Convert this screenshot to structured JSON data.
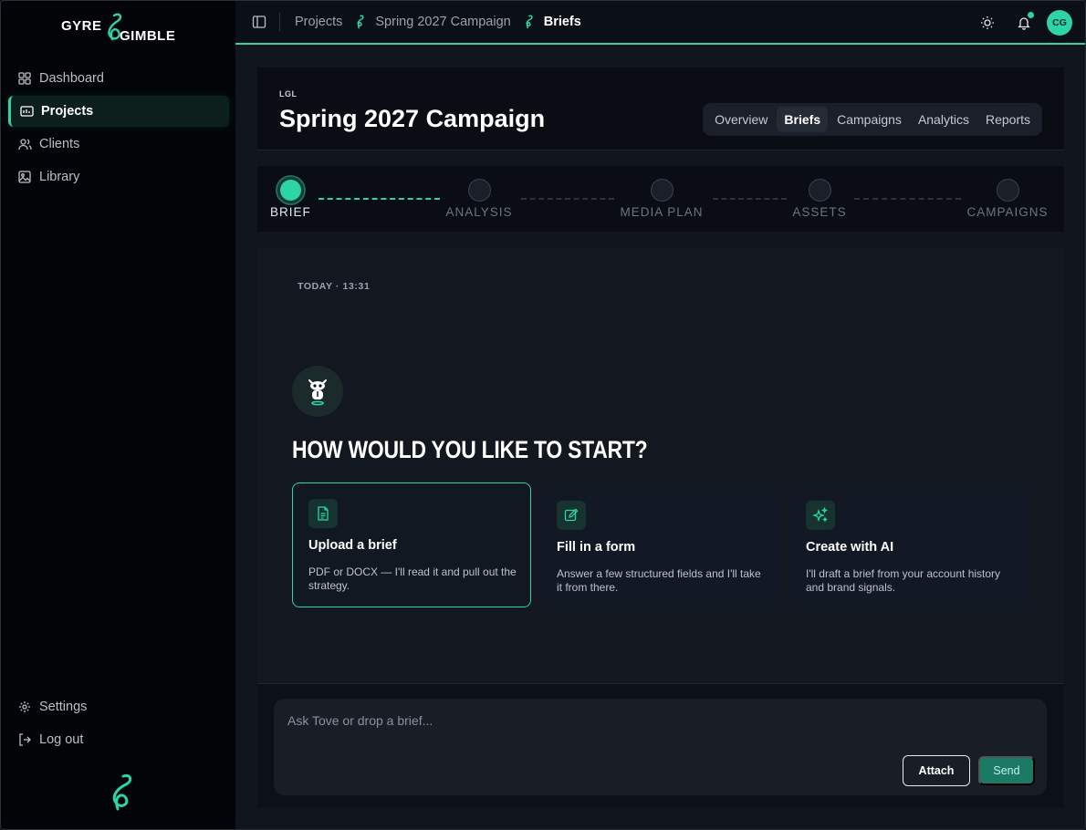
{
  "sidebar": {
    "brand": "GYRE & GIMBLE",
    "nav": [
      {
        "label": "Dashboard",
        "icon": "grid-icon"
      },
      {
        "label": "Projects",
        "icon": "folder-icon",
        "active": true
      },
      {
        "label": "Clients",
        "icon": "users-icon"
      },
      {
        "label": "Library",
        "icon": "image-icon"
      }
    ],
    "bottom_nav": [
      {
        "label": "Settings",
        "icon": "gear-icon"
      },
      {
        "label": "Log out",
        "icon": "logout-icon"
      }
    ]
  },
  "topbar": {
    "breadcrumbs": [
      "Projects",
      "Spring 2027 Campaign",
      "Briefs"
    ],
    "avatar_initials": "CG"
  },
  "header": {
    "client": "LGL",
    "title": "Spring 2027 Campaign",
    "tabs": [
      "Overview",
      "Briefs",
      "Campaigns",
      "Analytics",
      "Reports"
    ],
    "active_tab": "Briefs"
  },
  "stepper": {
    "steps": [
      "BRIEF",
      "ANALYSIS",
      "MEDIA PLAN",
      "ASSETS",
      "CAMPAIGNS"
    ],
    "current_index": 0
  },
  "chat": {
    "timestamp": "TODAY · 13:31",
    "heading": "HOW WOULD YOU LIKE TO START?",
    "options": [
      {
        "title": "Upload a brief",
        "description": "PDF or DOCX — I'll read it and pull out the strategy.",
        "icon": "document-icon",
        "selected": true
      },
      {
        "title": "Fill in a form",
        "description": "Answer a few structured fields and I'll take it from there.",
        "icon": "edit-icon"
      },
      {
        "title": "Create with AI",
        "description": "I'll draft a brief from your account history and brand signals.",
        "icon": "sparkle-icon"
      }
    ]
  },
  "composer": {
    "placeholder": "Ask Tove or drop a brief...",
    "attach_label": "Attach",
    "send_label": "Send"
  },
  "colors": {
    "accent": "#2dd4a7",
    "sidebar_bg": "#030408",
    "main_bg": "#11151d"
  }
}
